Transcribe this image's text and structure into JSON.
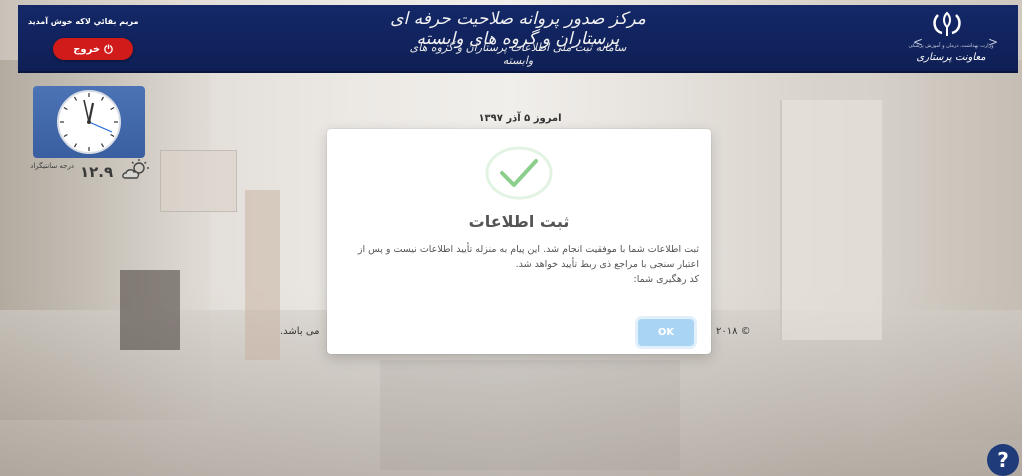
{
  "header": {
    "greeting": "مریم بقائي لاکه خوش آمدید",
    "logout_label": "خروج",
    "power_icon": "power-icon",
    "title": "مرکز صدور پروانه صلاحیت حرفه ای پرستاران و گروه های وابسته",
    "subtitle": "سامانه ثبت ملی اطلاعات پرستاران و گروه های وابسته",
    "ministry": "وزارت بهداشت، درمان و آموزش پزشکی",
    "deputy": "معاونت پرستاری"
  },
  "weather": {
    "label": "درجه سانتیگراد",
    "temperature": "۱۲.۹"
  },
  "date_line": "امروز ۵ آذر ۱۳۹۷",
  "footer": {
    "left_text": "می باشد.",
    "copyright": "۲۰۱۸ ©"
  },
  "dialog": {
    "title": "ثبت اطلاعات",
    "message": "ثبت اطلاعات شما با موفقیت انجام شد. این پیام به منزله تأیید اطلاعات نیست و پس از اعتبار سنجی با مراجع ذی ربط تأیید خواهد شد.",
    "tracking_label": "کد رهگیری شما:",
    "ok_label": "OK",
    "success_color": "#8ccf8c"
  },
  "help": {
    "label": "?"
  },
  "colors": {
    "header_bg": "#142868",
    "logout_bg": "#d11a1a",
    "clock_bg": "#4b73b5",
    "ok_bg": "#a9d4f4"
  }
}
